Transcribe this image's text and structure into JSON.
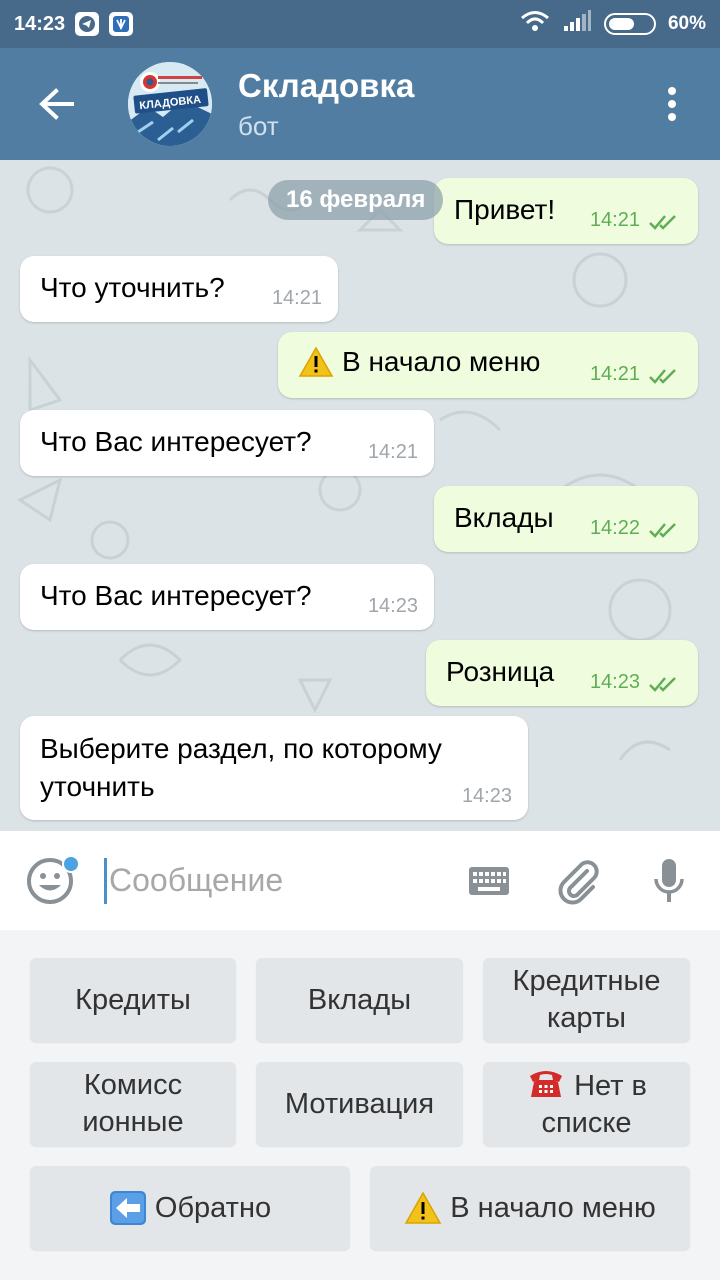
{
  "status_bar": {
    "time": "14:23",
    "battery": "60%",
    "battery_level": 0.6
  },
  "header": {
    "title": "Складовка",
    "subtitle": "бот",
    "avatar_text": "КЛАДОВКА"
  },
  "chat": {
    "date": "16 февраля",
    "messages": [
      {
        "direction": "out",
        "text": "Привет!",
        "time": "14:21",
        "read": true
      },
      {
        "direction": "in",
        "text": "Что уточнить?",
        "time": "14:21"
      },
      {
        "direction": "out",
        "text": "В начало меню",
        "time": "14:21",
        "read": true,
        "icon": "warning-icon"
      },
      {
        "direction": "in",
        "text": "Что Вас интересует?",
        "time": "14:21"
      },
      {
        "direction": "out",
        "text": "Вклады",
        "time": "14:22",
        "read": true
      },
      {
        "direction": "in",
        "text": "Что Вас интересует?",
        "time": "14:23"
      },
      {
        "direction": "out",
        "text": "Розница",
        "time": "14:23",
        "read": true
      },
      {
        "direction": "in",
        "text": "Выберите раздел, по которому уточнить",
        "time": "14:23"
      }
    ]
  },
  "input": {
    "placeholder": "Сообщение"
  },
  "keyboard": {
    "buttons": [
      {
        "label": "Кредиты"
      },
      {
        "label": "Вклады"
      },
      {
        "label": "Кредитные карты"
      },
      {
        "label": "Комисс ионные"
      },
      {
        "label": "Мотивация"
      },
      {
        "label": "Нет в списке",
        "icon": "telephone-icon"
      },
      {
        "label": "Обратно",
        "icon": "left-arrow-icon"
      },
      {
        "label": "В начало меню",
        "icon": "warning-icon"
      }
    ]
  },
  "colors": {
    "status_bar": "#47698a",
    "app_bar": "#527da3",
    "chat_background": "#dbe3e6",
    "outgoing_bubble": "#effdde",
    "incoming_bubble": "#ffffff",
    "read_ticks": "#5fae55"
  }
}
